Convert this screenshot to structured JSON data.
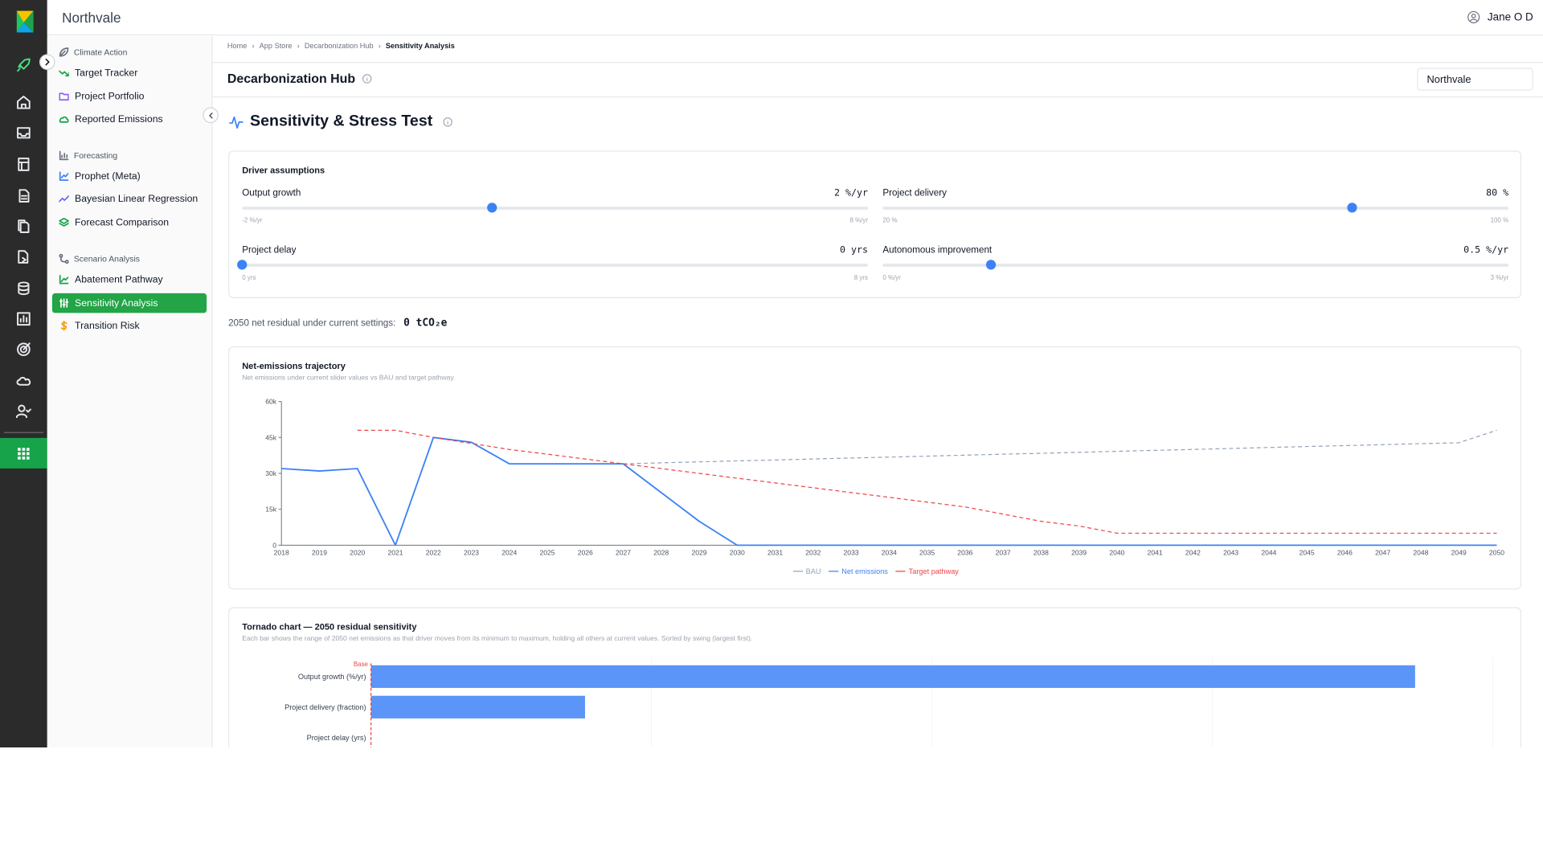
{
  "app": {
    "org_name": "Northvale",
    "user_name": "Jane O D"
  },
  "rail": {
    "icons": [
      "rocket-icon",
      "home-icon",
      "inbox-icon",
      "ledger-icon",
      "document-icon",
      "files-icon",
      "transfer-icon",
      "database-icon",
      "bar-chart-icon",
      "target-icon",
      "cloud-icon",
      "user-check-icon",
      "apps-grid-icon"
    ],
    "accent": "#16a34a"
  },
  "sidebar": {
    "sections": [
      {
        "title": "Climate Action",
        "items": [
          "Target Tracker",
          "Project Portfolio",
          "Reported Emissions"
        ]
      },
      {
        "title": "Forecasting",
        "items": [
          "Prophet (Meta)",
          "Bayesian Linear Regression",
          "Forecast Comparison"
        ]
      },
      {
        "title": "Scenario Analysis",
        "items": [
          "Abatement Pathway",
          "Sensitivity Analysis",
          "Transition Risk"
        ]
      }
    ],
    "active_item": "Sensitivity Analysis"
  },
  "breadcrumb": [
    "Home",
    "App Store",
    "Decarbonization Hub",
    "Sensitivity Analysis"
  ],
  "hub": {
    "title": "Decarbonization Hub",
    "org_select": "Northvale"
  },
  "page": {
    "title": "Sensitivity & Stress Test"
  },
  "drivers": {
    "title": "Driver assumptions",
    "sliders": [
      {
        "label": "Output growth",
        "value": "2 %/yr",
        "min": "-2 %/yr",
        "max": "8 %/yr",
        "fraction": 0.4
      },
      {
        "label": "Project delivery",
        "value": "80 %",
        "min": "20 %",
        "max": "100 %",
        "fraction": 0.75
      },
      {
        "label": "Project delay",
        "value": "0 yrs",
        "min": "0 yrs",
        "max": "8 yrs",
        "fraction": 0.0
      },
      {
        "label": "Autonomous improvement",
        "value": "0.5 %/yr",
        "min": "0 %/yr",
        "max": "3 %/yr",
        "fraction": 0.173
      }
    ]
  },
  "residual": {
    "label": "2050 net residual under current settings:",
    "value": "0 tCO₂e"
  },
  "trajectory": {
    "title": "Net-emissions trajectory",
    "subtitle": "Net emissions under current slider values vs BAU and target pathway."
  },
  "tornado": {
    "title": "Tornado chart — 2050 residual sensitivity",
    "subtitle": "Each bar shows the range of 2050 net emissions as that driver moves from its minimum to maximum, holding all others at current values. Sorted by swing (largest first).",
    "base_label": "Base"
  },
  "chart_data": [
    {
      "type": "line",
      "title": "Net-emissions trajectory",
      "x": [
        2018,
        2019,
        2020,
        2021,
        2022,
        2023,
        2024,
        2025,
        2026,
        2027,
        2028,
        2029,
        2030,
        2031,
        2032,
        2033,
        2034,
        2035,
        2036,
        2037,
        2038,
        2039,
        2040,
        2041,
        2042,
        2043,
        2044,
        2045,
        2046,
        2047,
        2048,
        2049,
        2050
      ],
      "yticks": [
        "0",
        "15k",
        "30k",
        "45k",
        "60k"
      ],
      "ylim": [
        0,
        60000
      ],
      "series": [
        {
          "name": "BAU",
          "color": "#94a3b8",
          "dashed": true,
          "values": [
            null,
            null,
            null,
            null,
            null,
            null,
            null,
            null,
            null,
            34000,
            34400,
            34800,
            35200,
            35600,
            36000,
            36400,
            36800,
            37200,
            37600,
            38000,
            38400,
            38800,
            39200,
            39600,
            40000,
            40400,
            40800,
            41200,
            41600,
            42000,
            42400,
            42800,
            48000
          ]
        },
        {
          "name": "Net emissions",
          "color": "#3b82f6",
          "dashed": false,
          "values": [
            32000,
            31000,
            32000,
            0,
            45000,
            43000,
            34000,
            34000,
            34000,
            34000,
            22000,
            10000,
            0,
            0,
            0,
            0,
            0,
            0,
            0,
            0,
            0,
            0,
            0,
            0,
            0,
            0,
            0,
            0,
            0,
            0,
            0,
            0,
            0
          ]
        },
        {
          "name": "Target pathway",
          "color": "#ef4444",
          "dashed": true,
          "values": [
            null,
            null,
            48000,
            48000,
            45000,
            42500,
            40000,
            38000,
            36000,
            34000,
            32000,
            30000,
            28000,
            26000,
            24000,
            22000,
            20000,
            18000,
            16000,
            13000,
            10000,
            8000,
            5000,
            5000,
            5000,
            5000,
            5000,
            5000,
            5000,
            5000,
            5000,
            5000,
            5000
          ]
        }
      ],
      "legend": [
        "BAU",
        "Net emissions",
        "Target pathway"
      ],
      "legend_position": "bottom-center"
    },
    {
      "type": "bar",
      "title": "Tornado chart — 2050 residual sensitivity",
      "orientation": "horizontal",
      "categories": [
        "Output growth (%/yr)",
        "Project delivery (fraction)",
        "Project delay (yrs)"
      ],
      "values": [
        1.0,
        0.205,
        0.0
      ],
      "baseline": 0,
      "color": "#5b95f7"
    }
  ]
}
